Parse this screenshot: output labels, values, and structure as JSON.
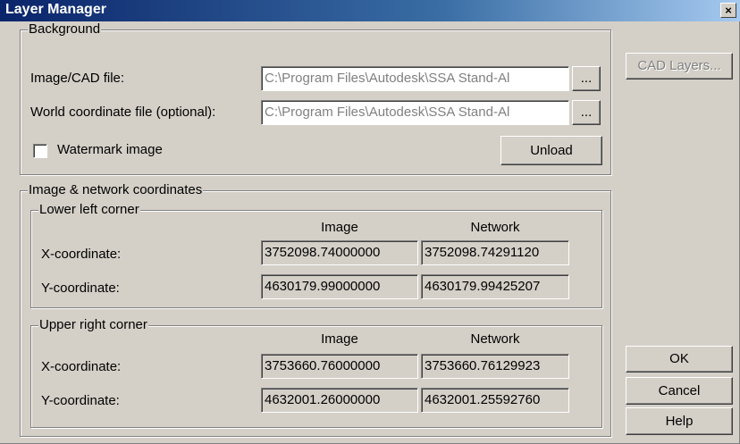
{
  "window": {
    "title": "Layer Manager",
    "close_glyph": "×"
  },
  "background": {
    "legend": "Background",
    "image_cad_label": "Image/CAD file:",
    "image_cad_value": "C:\\Program Files\\Autodesk\\SSA Stand-Al",
    "world_coord_label": "World coordinate file (optional):",
    "world_coord_value": "C:\\Program Files\\Autodesk\\SSA Stand-Al",
    "browse_label": "...",
    "watermark_label": "Watermark image",
    "watermark_checked": false,
    "unload_label": "Unload"
  },
  "coordinates": {
    "legend": "Image & network coordinates",
    "lower_left": {
      "legend": "Lower left corner",
      "image_header": "Image",
      "network_header": "Network",
      "x_label": "X-coordinate:",
      "y_label": "Y-coordinate:",
      "x_image": "3752098.74000000",
      "x_network": "3752098.74291120",
      "y_image": "4630179.99000000",
      "y_network": "4630179.99425207"
    },
    "upper_right": {
      "legend": "Upper right corner",
      "image_header": "Image",
      "network_header": "Network",
      "x_label": "X-coordinate:",
      "y_label": "Y-coordinate:",
      "x_image": "3753660.76000000",
      "x_network": "3753660.76129923",
      "y_image": "4632001.26000000",
      "y_network": "4632001.25592760"
    }
  },
  "buttons": {
    "cad_layers": "CAD Layers...",
    "ok": "OK",
    "cancel": "Cancel",
    "help": "Help"
  }
}
